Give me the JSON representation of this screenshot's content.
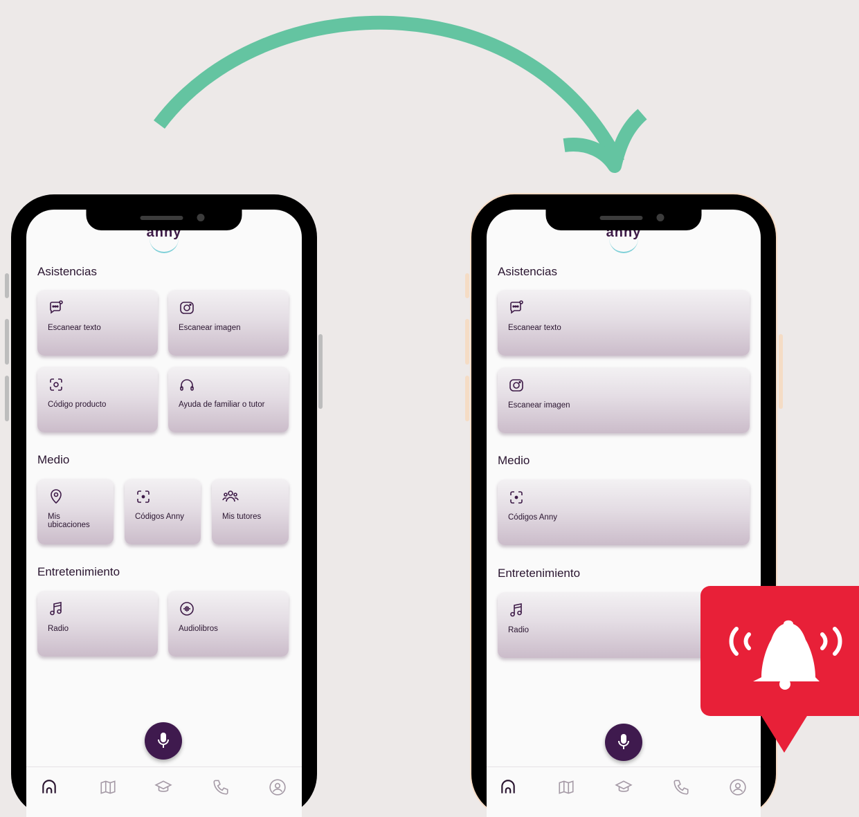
{
  "colors": {
    "background": "#ede9e8",
    "arrow": "#64c4a1",
    "accent": "#3f1a4e",
    "alert": "#e82038"
  },
  "phones": [
    {
      "logo": "anny",
      "section_asistencias": "Asistencias",
      "section_medio": "Medio",
      "section_entretenimiento": "Entretenimiento",
      "asistencias": [
        {
          "label": "Escanear texto",
          "icon": "chat-scan-icon"
        },
        {
          "label": "Escanear imagen",
          "icon": "camera-icon"
        },
        {
          "label": "Código producto",
          "icon": "barcode-scan-icon"
        },
        {
          "label": "Ayuda de familiar o tutor",
          "icon": "headphones-icon"
        }
      ],
      "medio": [
        {
          "label": "Mis ubicaciones",
          "icon": "location-pin-icon"
        },
        {
          "label": "Códigos Anny",
          "icon": "qr-scan-icon"
        },
        {
          "label": "Mis tutores",
          "icon": "group-icon"
        }
      ],
      "entretenimiento": [
        {
          "label": "Radio",
          "icon": "music-note-icon"
        },
        {
          "label": "Audiolibros",
          "icon": "audio-wave-icon"
        }
      ]
    },
    {
      "logo": "anny",
      "section_asistencias": "Asistencias",
      "section_medio": "Medio",
      "section_entretenimiento": "Entretenimiento",
      "asistencias": [
        {
          "label": "Escanear texto",
          "icon": "chat-scan-icon"
        },
        {
          "label": "Escanear imagen",
          "icon": "camera-icon"
        }
      ],
      "medio": [
        {
          "label": "Códigos Anny",
          "icon": "qr-scan-icon"
        }
      ],
      "entretenimiento": [
        {
          "label": "Radio",
          "icon": "music-note-icon"
        }
      ]
    }
  ],
  "tabbar": [
    "home-icon",
    "map-icon",
    "graduation-cap-icon",
    "phone-icon",
    "profile-icon"
  ]
}
